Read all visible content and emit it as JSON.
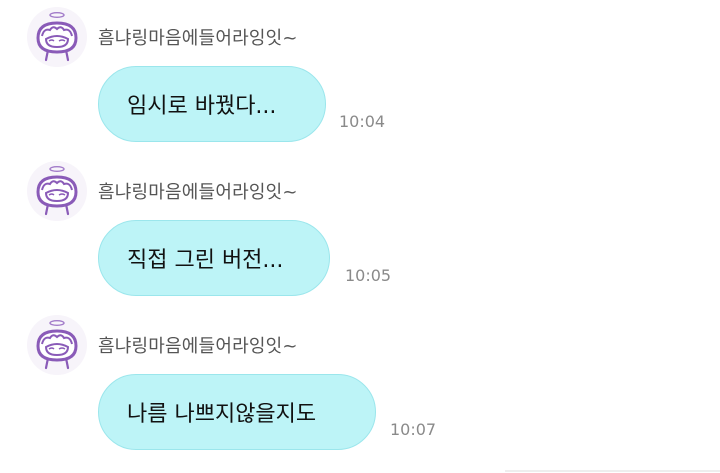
{
  "sender_name": "흠냐링마음에들어라잉잇~",
  "messages": [
    {
      "text": "임시로 바꿨다...",
      "time": "10:04"
    },
    {
      "text": "직접 그린 버전...",
      "time": "10:05"
    },
    {
      "text": "나름 나쁘지않을지도",
      "time": "10:07"
    }
  ],
  "colors": {
    "bubble": "#bdf4f7",
    "bubble_border": "#9be6ec",
    "avatar_purple": "#8a5bb8"
  },
  "icons": {
    "avatar": "hand-drawn-character-with-halo-icon"
  }
}
